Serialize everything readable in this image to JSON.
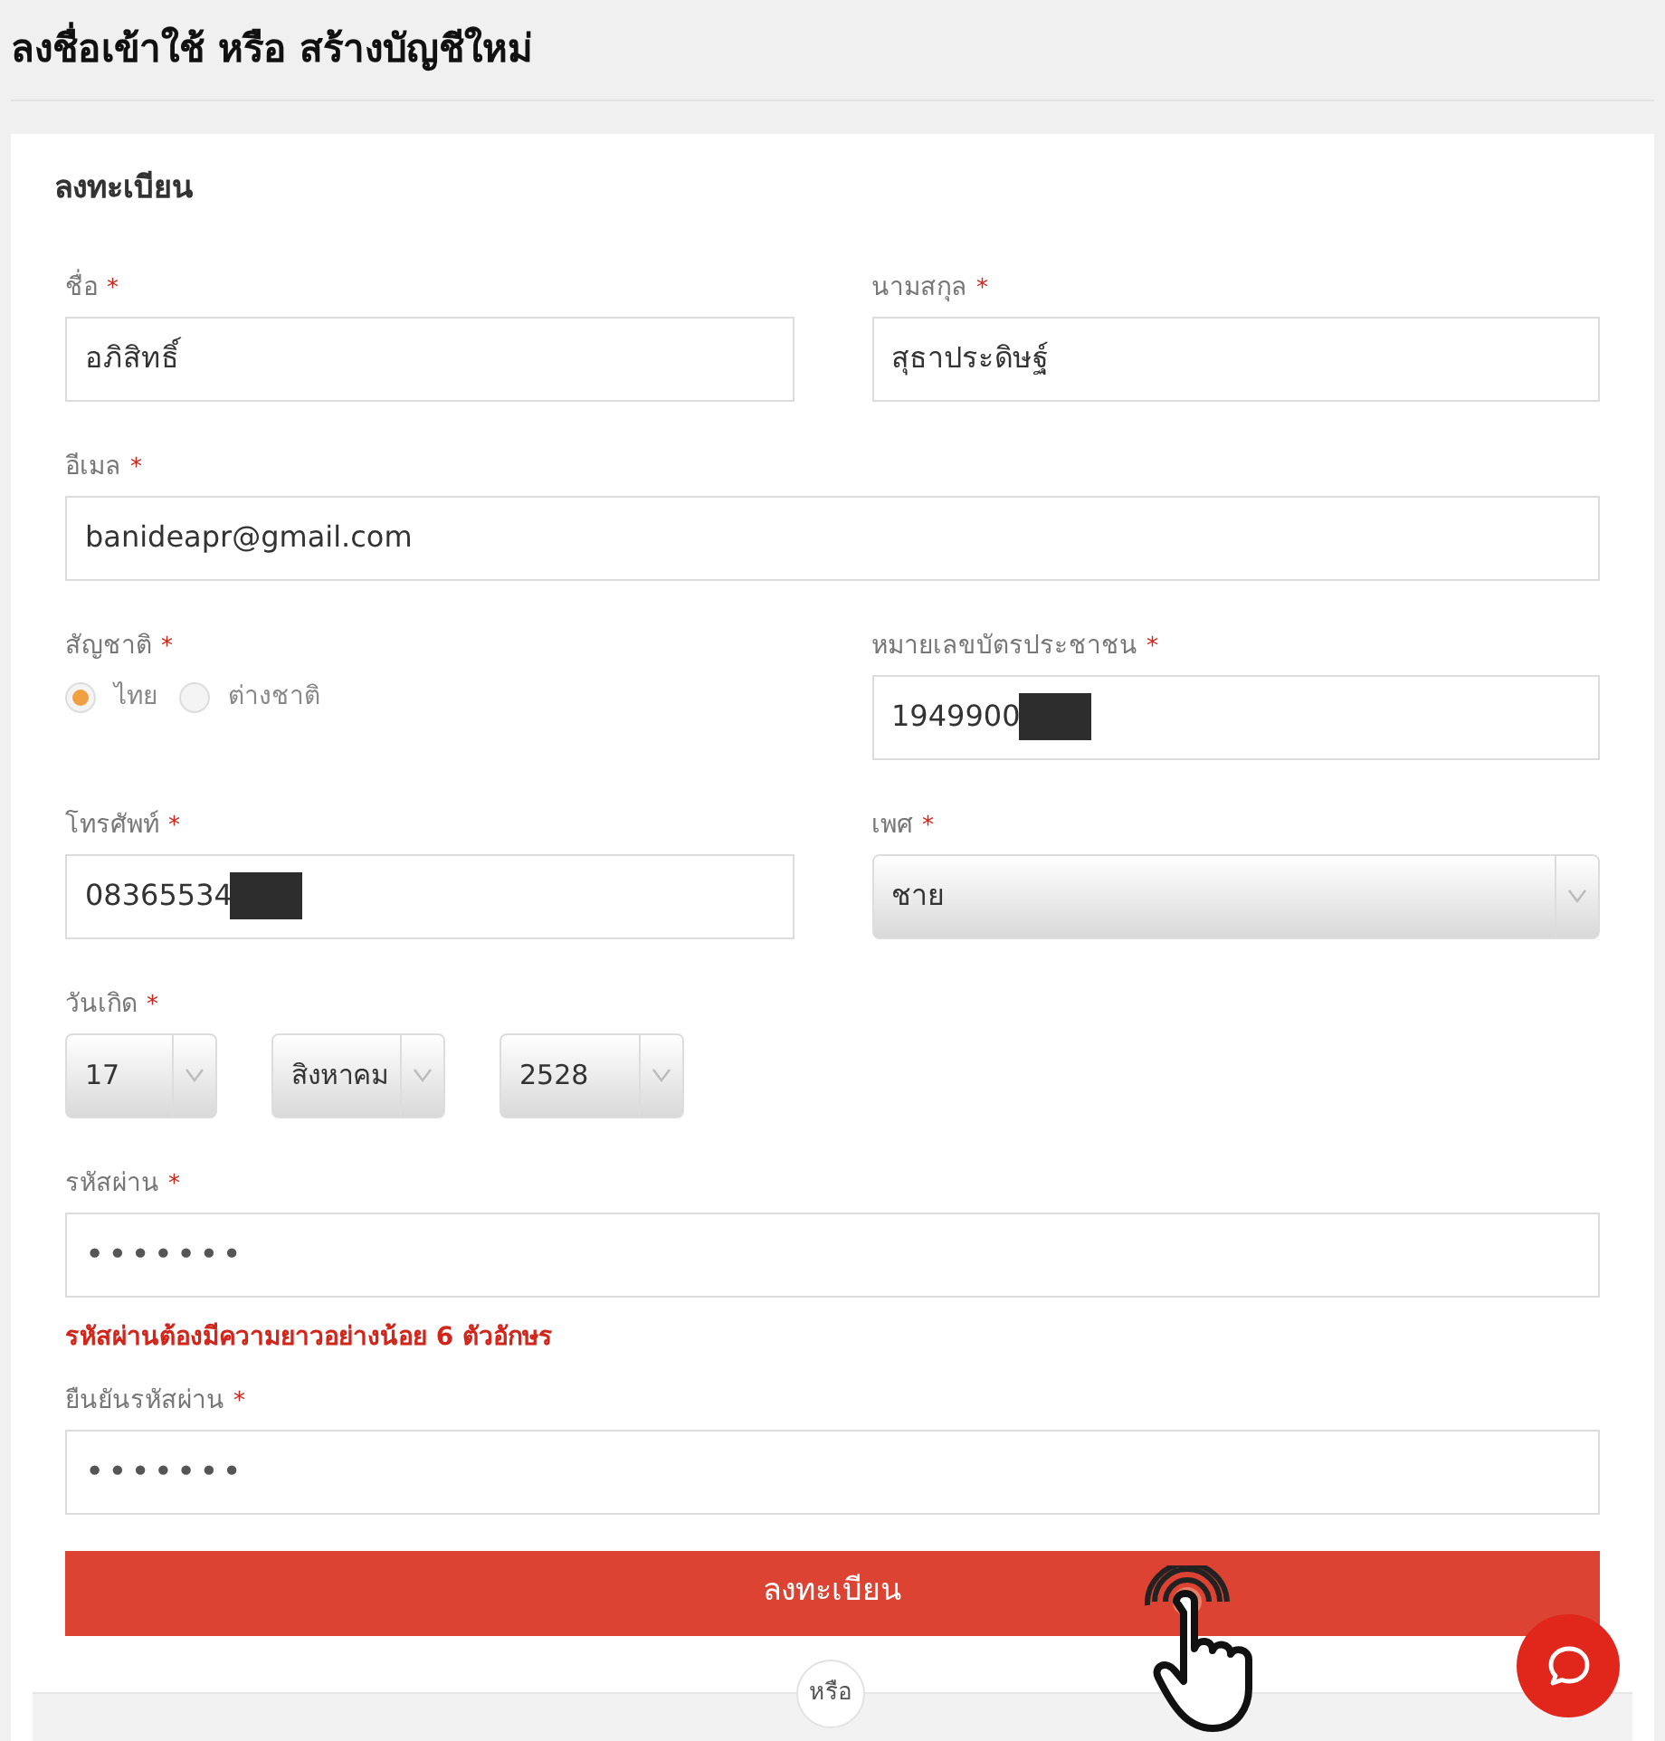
{
  "page_title": "ลงชื่อเข้าใช้ หรือ สร้างบัญชีใหม่",
  "form": {
    "title": "ลงทะเบียน",
    "rows": [
      [
        {
          "kind": "text",
          "label": "ชื่อ",
          "required_mark": "*",
          "value": "อภิสิทธิ์"
        },
        {
          "kind": "text",
          "label": "นามสกุล",
          "required_mark": "*",
          "value": "สุธาประดิษฐ์"
        }
      ],
      [
        {
          "kind": "text",
          "label": "อีเมล",
          "required_mark": "*",
          "value": "banideapr@gmail.com"
        }
      ],
      [
        {
          "kind": "radio",
          "label": "สัญชาติ",
          "required_mark": "*",
          "options": [
            {
              "label": "ไทย",
              "selected": true
            },
            {
              "label": "ต่างชาติ",
              "selected": false
            }
          ]
        },
        {
          "kind": "text",
          "label": "หมายเลขบัตรประชาชน",
          "required_mark": "*",
          "value": "1949900",
          "redacted": true
        }
      ],
      [
        {
          "kind": "text",
          "label": "โทรศัพท์",
          "required_mark": "*",
          "value": "08365534",
          "redacted": true
        },
        {
          "kind": "select",
          "label": "เพศ",
          "required_mark": "*",
          "value": "ชาย"
        }
      ],
      [
        {
          "kind": "date",
          "label": "วันเกิด",
          "required_mark": "*",
          "parts": [
            "17",
            "สิงหาคม",
            "2528"
          ]
        }
      ],
      [
        {
          "kind": "password",
          "label": "รหัสผ่าน",
          "required_mark": "*",
          "value": "•••••••",
          "error": "รหัสผ่านต้องมีความยาวอย่างน้อย 6 ตัวอักษร"
        }
      ],
      [
        {
          "kind": "password",
          "label": "ยืนยันรหัสผ่าน",
          "required_mark": "*",
          "value": "•••••••"
        }
      ]
    ],
    "submit": "ลงทะเบียน",
    "separator": "หรือ"
  }
}
